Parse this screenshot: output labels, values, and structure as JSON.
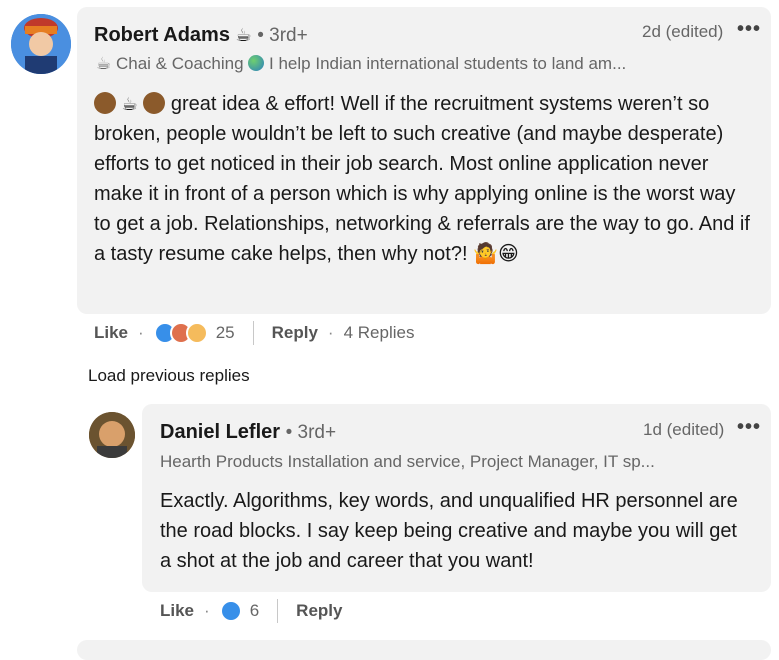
{
  "comment": {
    "author": "Robert Adams",
    "degree": "• 3rd+",
    "time": "2d (edited)",
    "headline": "Chai & Coaching",
    "headline_rest": "I help Indian international students to land am...",
    "text": "great idea & effort! Well if the recruitment systems weren’t so broken, people wouldn’t be left to such creative (and maybe desperate) efforts to get noticed in their job search. Most online application never make it in front of a person which is why applying online is the worst way to get a job. Relationships, networking & referrals are the way to go. And if a tasty resume cake helps, then why not?!",
    "like_label": "Like",
    "reaction_count": "25",
    "reply_label": "Reply",
    "replies_label": "4 Replies"
  },
  "load_previous": "Load previous replies",
  "reply": {
    "author": "Daniel Lefler",
    "degree": "• 3rd+",
    "time": "1d (edited)",
    "headline": "Hearth Products Installation and service, Project Manager, IT sp...",
    "text": "Exactly. Algorithms, key words, and unqualified HR personnel are the road blocks. I say keep being creative and maybe you will get a shot at the job and career that you want!",
    "like_label": "Like",
    "reaction_count": "6",
    "reply_label": "Reply"
  },
  "icons": {
    "more": "more-options-icon",
    "coffee": "coffee-cup-icon",
    "globe": "globe-icon",
    "like": "like-reaction-icon",
    "love": "love-reaction-icon",
    "insightful": "insightful-reaction-icon"
  }
}
